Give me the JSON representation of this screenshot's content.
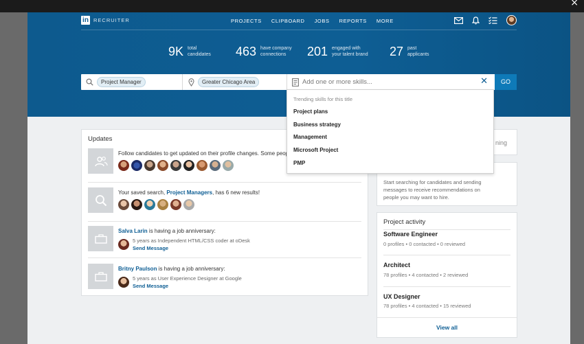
{
  "window": {
    "close_glyph": "×"
  },
  "brand": {
    "logo_letters": "in",
    "product": "RECRUITER",
    "accent": "#0e5e94"
  },
  "nav": {
    "links": [
      "PROJECTS",
      "CLIPBOARD",
      "JOBS",
      "REPORTS",
      "MORE"
    ],
    "icons": [
      "mail-icon",
      "bell-icon",
      "tasks-icon",
      "profile-avatar"
    ]
  },
  "stats": [
    {
      "value": "9K",
      "label1": "total",
      "label2": "candidates"
    },
    {
      "value": "463",
      "label1": "have company",
      "label2": "connections"
    },
    {
      "value": "201",
      "label1": "engaged with",
      "label2": "your talent brand"
    },
    {
      "value": "27",
      "label1": "past",
      "label2": "applicants"
    }
  ],
  "search": {
    "title_pill": "Project Manager",
    "location_pill": "Greater Chicago Area",
    "skills_placeholder": "Add one or more skills...",
    "clear_glyph": "✕",
    "go_label": "GO"
  },
  "dropdown": {
    "heading": "Trending skills for this title",
    "items": [
      "Project plans",
      "Business strategy",
      "Management",
      "Microsoft Project",
      "PMP"
    ]
  },
  "updates": {
    "title": "Updates",
    "items": [
      {
        "text": "Follow candidates to get updated on their profile changes. Some peop"
      },
      {
        "pre": "Your saved search, ",
        "link": "Project Managers",
        "post": ", has 6 new results!"
      },
      {
        "name": "Salva Larin",
        "post": " is having a job anniversary:",
        "detail": "5 years as Independent HTML/CSS coder at oDesk",
        "action": "Send Message"
      },
      {
        "name": "Britny Paulson",
        "post": " is having a job anniversary:",
        "detail": "5 years as User Experience Designer at Google",
        "action": "Send Message"
      }
    ]
  },
  "side_card_1": {
    "partial_text": "ning"
  },
  "side_card_2": {
    "text": [
      "Start searching for candidates and sending",
      "messages to receive recommendations on",
      "people you may want to hire."
    ]
  },
  "project_activity": {
    "title": "Project activity",
    "projects": [
      {
        "name": "Software Engineer",
        "meta": "0 profiles  •  0 contacted  •  0 reviewed"
      },
      {
        "name": "Architect",
        "meta": "78 profiles  •  4 contacted  •  2 reviewed"
      },
      {
        "name": "UX Designer",
        "meta": "78 profiles  •  4 contacted  •  15 reviewed"
      }
    ],
    "view_all": "View all"
  }
}
